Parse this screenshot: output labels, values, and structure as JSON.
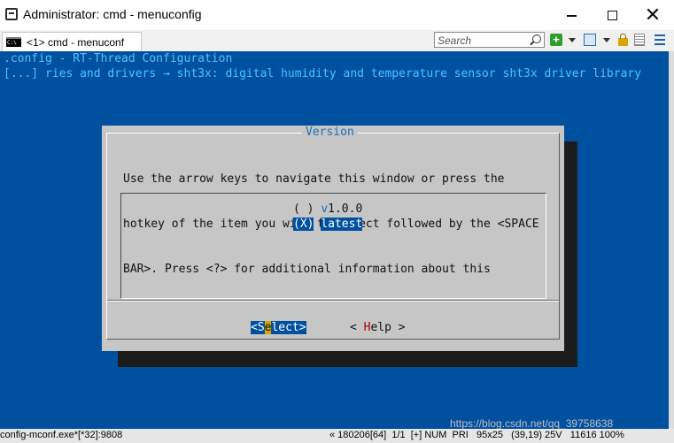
{
  "window": {
    "title": "Administrator: cmd - menuconfig",
    "minimize_icon": "minimize-icon",
    "maximize_icon": "maximize-icon",
    "close_glyph": "✕"
  },
  "tabbar": {
    "tab_label": "<1> cmd - menuconf",
    "tab_icon_text": "C:\\",
    "search_placeholder": "Search",
    "plus_glyph": "+"
  },
  "console": {
    "line1": ".config - RT-Thread Configuration",
    "line2": "[...] ries and drivers → sht3x: digital humidity and temperature sensor sht3x driver library"
  },
  "dialog": {
    "title": "Version",
    "help_line1": "Use the arrow keys to navigate this window or press the",
    "help_line2": "hotkey of the item you wish to select followed by the <SPACE",
    "help_line3": "BAR>. Press <?> for additional information about this",
    "options": [
      {
        "mark": "( )",
        "hotkey": "v",
        "label_rest": "1.0.0",
        "selected": false
      },
      {
        "mark": "(X)",
        "label": "latest",
        "selected": true
      }
    ],
    "buttons": {
      "select_open": "<S",
      "select_hotkey": "e",
      "select_rest": "lect>",
      "help_open": "< ",
      "help_hotkey": "H",
      "help_rest": "elp >"
    }
  },
  "statusbar": {
    "process": "config-mconf.exe*[*32]:9808",
    "info": "« 180206[64]  1/1  [+] NUM  PRI   95x25   (39,19) 25V   11616 100%"
  },
  "watermark": "https://blog.csdn.net/qq_39758638",
  "colors": {
    "console_bg": "#0050a0",
    "dialog_bg": "#c6c6c6",
    "accent_text": "#4fc3f7",
    "highlight": "#0050a0",
    "hotkey_yellow": "#d9a400",
    "hotkey_red": "#b00000"
  }
}
